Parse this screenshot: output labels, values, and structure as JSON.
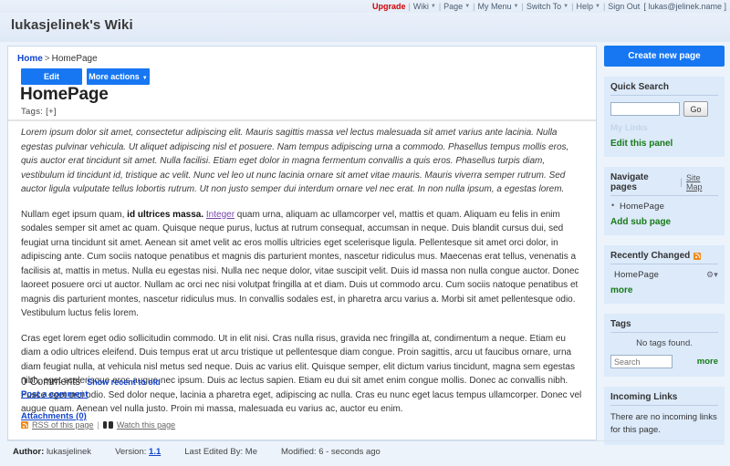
{
  "topnav": {
    "upgrade": "Upgrade",
    "items": [
      {
        "label": "Wiki",
        "has_caret": true
      },
      {
        "label": "Page",
        "has_caret": true
      },
      {
        "label": "My Menu",
        "has_caret": true
      },
      {
        "label": "Switch To",
        "has_caret": true
      },
      {
        "label": "Help",
        "has_caret": true
      }
    ],
    "signout": "Sign Out",
    "user": "[ lukas@jelinek.name ]"
  },
  "header": {
    "site_title": "lukasjelinek's Wiki"
  },
  "breadcrumb": {
    "home": "Home",
    "separator": ">",
    "current": "HomePage"
  },
  "toolbar": {
    "edit_label": "Edit",
    "more_actions_label": "More actions",
    "caret": "▾"
  },
  "page": {
    "title": "HomePage",
    "tags_label": "Tags: [+]",
    "paragraphs": {
      "p1": "Lorem ipsum dolor sit amet, consectetur adipiscing elit. Mauris sagittis massa vel lectus malesuada sit amet varius ante lacinia. Nulla egestas pulvinar vehicula. Ut aliquet adipiscing nisl et posuere. Nam tempus adipiscing urna a commodo. Phasellus tempus mollis eros, quis auctor erat tincidunt sit amet. Nulla facilisi. Etiam eget dolor in magna fermentum convallis a quis eros. Phasellus turpis diam, vestibulum id tincidunt id, tristique ac velit. Nunc vel leo ut nunc lacinia ornare sit amet vitae mauris. Mauris viverra semper rutrum. Sed auctor ligula vulputate tellus lobortis rutrum. Ut non justo semper dui interdum ornare vel nec erat. In non nulla ipsum, a egestas lorem.",
      "p2_before": "Nullam eget ipsum quam, ",
      "p2_bold": "id ultrices massa.",
      "p2_link": "Integer",
      "p2_after": " quam urna, aliquam ac ullamcorper vel, mattis et quam. Aliquam eu felis in enim sodales semper sit amet ac quam. Quisque neque purus, luctus at rutrum consequat, accumsan in neque. Duis blandit cursus dui, sed feugiat urna tincidunt sit amet. Aenean sit amet velit ac eros mollis ultricies eget scelerisque ligula. Pellentesque sit amet orci dolor, in adipiscing ante. Cum sociis natoque penatibus et magnis dis parturient montes, nascetur ridiculus mus. Maecenas erat tellus, venenatis a facilisis at, mattis in metus. Nulla eu egestas nisi. Nulla nec neque dolor, vitae suscipit velit. Duis id massa non nulla congue auctor. Donec laoreet posuere orci ut auctor. Nullam ac orci nec nisi volutpat fringilla at et diam. Duis ut commodo arcu. Cum sociis natoque penatibus et magnis dis parturient montes, nascetur ridiculus mus. In convallis sodales est, in pharetra arcu varius a. Morbi sit amet pellentesque odio. Vestibulum luctus felis lorem.",
      "p3": "Cras eget lorem eget odio sollicitudin commodo. Ut in elit nisi. Cras nulla risus, gravida nec fringilla at, condimentum a neque. Etiam eu diam a odio ultrices eleifend. Duis tempus erat ut arcu tristique ut pellentesque diam congue. Proin sagittis, arcu ut faucibus ornare, urna diam feugiat nulla, at vehicula nisl metus sed neque. Duis ac varius elit. Quisque semper, elit dictum varius tincidunt, magna sem egestas nibh, eget scelerisque eros augue nec ipsum. Duis ac lectus sapien. Etiam eu dui sit amet enim congue mollis. Donec ac convallis nibh. Fusce eget orci odio. Sed dolor neque, lacinia a pharetra eget, adipiscing ac nulla. Cras eu nunc eget lacus tempus ullamcorper. Donec vel augue quam. Aenean vel nulla justo. Proin mi massa, malesuada eu varius ac, auctor eu enim."
    }
  },
  "comments": {
    "count_label": "0 Comments",
    "sort_link": "Show recent to old",
    "post_link": "Post a comment"
  },
  "attachments": {
    "label": "Attachments (0)"
  },
  "content_footer": {
    "rss_label": "RSS of this page",
    "separator": "|",
    "watch_label": "Watch this page"
  },
  "statusbar": {
    "author_label": "Author:",
    "author_value": "lukasjelinek",
    "version_label": "Version:",
    "version_value": "1.1",
    "last_edited_label": "Last Edited By:",
    "last_edited_value": "Me",
    "modified_label": "Modified:",
    "modified_value": "6 - seconds ago"
  },
  "sidebar": {
    "create_button": "Create new page",
    "quick_search": {
      "title": "Quick Search",
      "input_value": "",
      "go_label": "Go",
      "my_links": "My Links",
      "edit_panel": "Edit this panel"
    },
    "navigate": {
      "title": "Navigate pages",
      "pipe": "|",
      "sitemap": "Site Map",
      "pages": [
        "HomePage"
      ],
      "add_sub_page": "Add sub page"
    },
    "recently_changed": {
      "title": "Recently Changed",
      "items": [
        "HomePage"
      ],
      "gear": "⚙▾",
      "more": "more"
    },
    "tags": {
      "title": "Tags",
      "empty_text": "No tags found.",
      "search_placeholder": "Search",
      "more": "more"
    },
    "incoming_links": {
      "title": "Incoming Links",
      "text": "There are no incoming links for this page."
    }
  }
}
